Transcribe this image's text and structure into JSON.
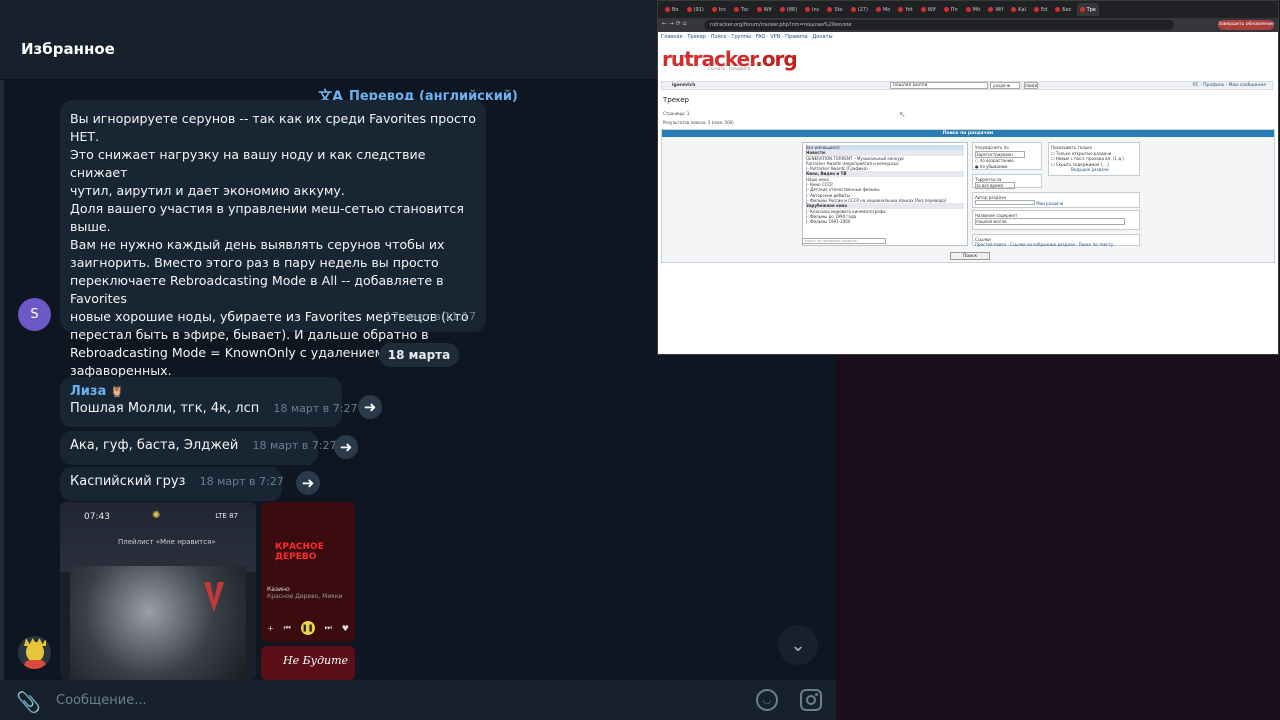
{
  "telegram": {
    "header_title": "Избранное",
    "translate_label": "Перевод (английский)",
    "long_message": {
      "avatar_letter": "S",
      "text": "Вы игнорируете серунов -- так как их среди Favorites просто НЕТ.\nЭто снижает нагрузку на вашу ноду и как следствие снижает\nчутил, аирутил и дает экономию аккуму.\nДоля вашего участия в управлении меш-сетью становится\nвыше.\nВам не нужно каждый день выявлять серунов чтобы их\nзаигнорить. Вместо этого раз в пару недель вы просто\nпереключаете Rebroadcasting Mode в All -- добавляете в Favorites\nновые хорошие ноды, убираете из Favorites мертвецов (кто\nперестал быть в эфире, бывает). И дальше обратно в\nRebroadcasting Mode = KnownOnly с удалением всех  НЕ\nзафаворенных.",
      "time": "17 март в 11:17"
    },
    "date_separator": "18 марта",
    "messages": [
      {
        "author": "Лиза",
        "author_emoji": "🦉",
        "text": "Пошлая Молли, тгк, 4к, лсп",
        "time": "18 март в 7:27"
      },
      {
        "text": "Ака, гуф, баста, Элджей",
        "time": "18 март в 7:27"
      },
      {
        "text": "Каспийский груз",
        "time": "18 март в 7:27"
      }
    ],
    "phone_screenshot": {
      "time": "07:43",
      "network": "LTE",
      "battery": "87",
      "playlist": "Плейлист «Мне нравится»"
    },
    "red_cover": {
      "title_lines": [
        "КРАСНОЕ",
        "ДЕРЕВО"
      ],
      "track": "Казино",
      "artist": "Красное Дерево, Микки"
    },
    "red_cover_2": {
      "text": "Не Будите"
    },
    "input_placeholder": "Сообщение..."
  },
  "browser": {
    "tabs": [
      "Bo",
      "(91)",
      "Inc",
      "Tsc",
      "Wif",
      "(88)",
      "Inc",
      "Sto",
      "(27)",
      "Mo",
      "Yot",
      "Wif",
      "Пл",
      "Mit",
      "Wif",
      "Kal",
      "Ed",
      "Бес",
      "Tpe"
    ],
    "active_tab": "Tpe",
    "url": "rutracker.org/forum/tracker.php?nm=пошлая%20молли",
    "update_label": "Завершить обновление",
    "site": {
      "top_nav": "Главная · Трекер · Поиск · Группы · FAQ · VPN · Правила · Донаты",
      "logo_main": "rutracker",
      "logo_tld": ".org",
      "tagline": "Скачать · Раздавать",
      "user": "igorevich",
      "search_query": "пошлая молли",
      "search_scope": "раздачи",
      "search_go": "поиск",
      "bar_right": "ЛС · Профиль · Мои сообщения",
      "page_title": "Трекер",
      "pages": "Страницы: 1",
      "results": "Результатов поиска: 5 (max: 500)",
      "panel_title": "Поиск по раздачам",
      "categories": [
        {
          "label": "Все имеющиеся",
          "kind": "hl"
        },
        {
          "label": "Новости",
          "kind": "grp"
        },
        {
          "label": "GENERATION.TORRENT – Музыкальный конкурс",
          "kind": "item"
        },
        {
          "label": "Rutracker Awards (мероприятия и конкурсы)",
          "kind": "item"
        },
        {
          "label": "|- Rutracker Awards (Графика)",
          "kind": "item"
        },
        {
          "label": "Кино, Видео и ТВ",
          "kind": "grp"
        },
        {
          "label": "Наше кино",
          "kind": "item"
        },
        {
          "label": "|- Кино СССР",
          "kind": "item"
        },
        {
          "label": "|- Детские отечественные фильмы",
          "kind": "item"
        },
        {
          "label": "|- Авторские дебюты",
          "kind": "item"
        },
        {
          "label": "|- Фильмы России и СССР на национальных языках [без перевода]",
          "kind": "item"
        },
        {
          "label": "Зарубежное кино",
          "kind": "grp"
        },
        {
          "label": "|- Классика мирового кинематографа",
          "kind": "item"
        },
        {
          "label": "|- Фильмы до 1990 года",
          "kind": "item"
        },
        {
          "label": "|- Фильмы 1991-2000",
          "kind": "item"
        }
      ],
      "cat_search_placeholder": "поиск по названию раздела",
      "sort_by": "Упорядочить по",
      "sort_field": "Зарегистрирован",
      "order_asc": "по возрастанию",
      "order_desc": "по убыванию",
      "show_only": "Показывать только",
      "show_opts": [
        "Только открытые раздачи",
        "Новые с посл. прохода вп. (1 д.)",
        "Скрыть содержимое {...}"
      ],
      "show_link": "Ведущие раздачи",
      "torrents_for": "Торренты за",
      "torrents_for_val": "за все время",
      "author_label": "Автор раздачи",
      "author_my": "Мои раздачи",
      "title_label": "Название содержит",
      "title_val": "пошлая молли",
      "links_label": "Ссылки",
      "links": "Простой поиск · Ссылки на избранные раздачи · Поиск по тексту",
      "submit": "Поиск"
    }
  }
}
